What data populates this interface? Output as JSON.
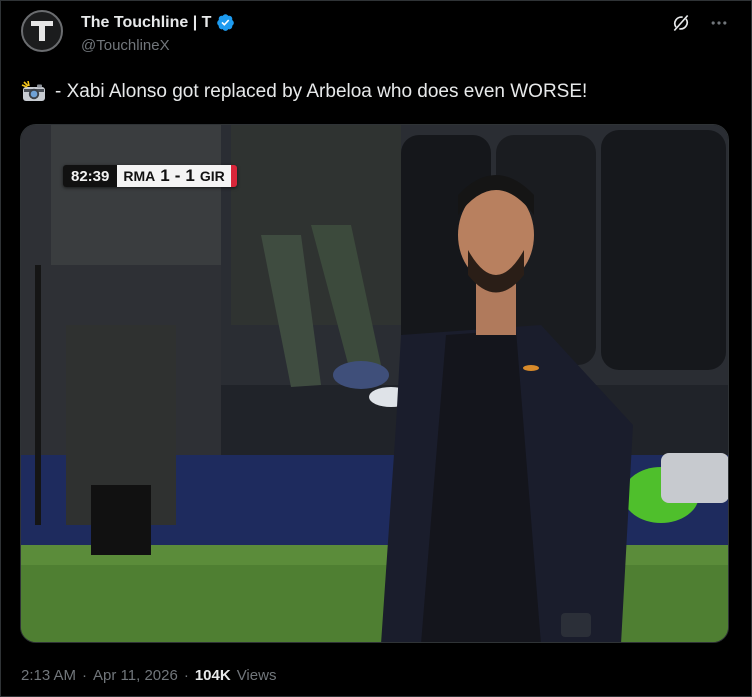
{
  "author": {
    "display_name": "The Touchline | T",
    "handle": "@TouchlineX",
    "avatar_letter": "T",
    "verified": true,
    "verified_color": "#1d9bf0"
  },
  "tweet": {
    "emoji_icon": "camera-with-flash-icon",
    "text": "- Xabi Alonso got replaced by Arbeloa who does even WORSE!"
  },
  "media": {
    "scorebug": {
      "clock": "82:39",
      "home": "RMA",
      "home_score": "1",
      "separator": "-",
      "away_score": "1",
      "away": "GIR"
    }
  },
  "meta": {
    "time": "2:13 AM",
    "dot1": "·",
    "date": "Apr 11, 2026",
    "dot2": "·",
    "views_count": "104K",
    "views_label": "Views"
  },
  "colors": {
    "background": "#000000",
    "text": "#e7e9ea",
    "secondary": "#71767b",
    "accent": "#1d9bf0"
  }
}
